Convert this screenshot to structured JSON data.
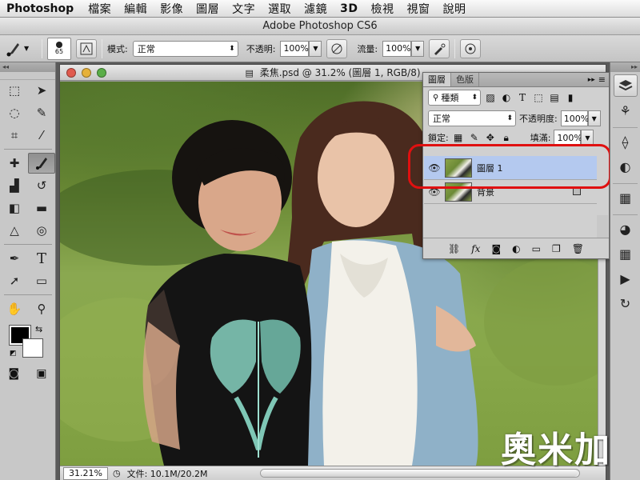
{
  "menubar": {
    "app": "Photoshop",
    "items": [
      "檔案",
      "編輯",
      "影像",
      "圖層",
      "文字",
      "選取",
      "濾鏡",
      "3D",
      "檢視",
      "視窗",
      "說明"
    ]
  },
  "app_title": "Adobe Photoshop CS6",
  "options": {
    "brush_size": "65",
    "mode_label": "模式:",
    "mode_value": "正常",
    "opacity_label": "不透明:",
    "opacity_value": "100%",
    "flow_label": "流量:",
    "flow_value": "100%"
  },
  "tools": {
    "header": "◂◂",
    "icons": [
      "marquee-icon",
      "move-icon",
      "lasso-icon",
      "quick-selection-icon",
      "crop-icon",
      "eyedropper-icon",
      "healing-brush-icon",
      "brush-icon",
      "clone-stamp-icon",
      "history-brush-icon",
      "eraser-icon",
      "gradient-icon",
      "blur-icon",
      "dodge-icon",
      "pen-icon",
      "type-icon",
      "path-selection-icon",
      "shape-icon",
      "hand-icon",
      "zoom-icon"
    ],
    "foreground_color": "#000000",
    "background_color": "#ffffff"
  },
  "document": {
    "title": "柔焦.psd @ 31.2% (圖層 1, RGB/8)",
    "zoom": "31.21%",
    "doc_size": "文件: 10.1M/20.2M"
  },
  "layers_panel": {
    "tabs": [
      "圖層",
      "色版"
    ],
    "filter_kind": "種類",
    "blend_mode": "正常",
    "opacity_label": "不透明度:",
    "opacity_value": "100%",
    "lock_label": "鎖定:",
    "fill_label": "填滿:",
    "fill_value": "100%",
    "layers": [
      {
        "name": "圖層 1",
        "selected": true,
        "locked": false
      },
      {
        "name": "背景",
        "selected": false,
        "locked": true
      }
    ],
    "footer_icons": [
      "link-icon",
      "fx-icon",
      "mask-icon",
      "adjustment-icon",
      "group-icon",
      "new-layer-icon",
      "trash-icon"
    ],
    "highlight_color": "#e01010"
  },
  "dock": {
    "icons": [
      "layers-icon",
      "channels-icon",
      "paths-icon",
      "adjustments-icon",
      "properties-icon",
      "swatches-icon",
      "actions-icon",
      "history-icon"
    ]
  },
  "watermark": "奧米加"
}
